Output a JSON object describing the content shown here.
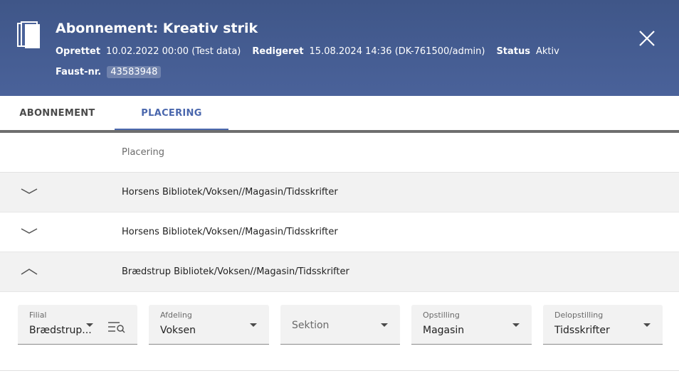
{
  "header": {
    "title": "Abonnement: Kreativ strik",
    "oprettet_label": "Oprettet",
    "oprettet_value": "10.02.2022 00:00 (Test data)",
    "redigeret_label": "Redigeret",
    "redigeret_value": "15.08.2024 14:36 (DK-761500/admin)",
    "status_label": "Status",
    "status_value": "Aktiv",
    "faust_label": "Faust-nr.",
    "faust_value": "43583948",
    "icon": "books-icon",
    "close_icon": "close-icon"
  },
  "tabs": [
    {
      "label": "ABONNEMENT",
      "active": false
    },
    {
      "label": "PLACERING",
      "active": true
    }
  ],
  "table": {
    "column_header": "Placering",
    "rows": [
      {
        "path": "Horsens Bibliotek/Voksen//Magasin/Tidsskrifter",
        "expanded": false
      },
      {
        "path": "Horsens Bibliotek/Voksen//Magasin/Tidsskrifter",
        "expanded": false
      },
      {
        "path": "Brædstrup Bibliotek/Voksen//Magasin/Tidsskrifter",
        "expanded": true
      }
    ]
  },
  "details": {
    "filial": {
      "label": "Filial",
      "value": "Brædstrup..."
    },
    "afdeling": {
      "label": "Afdeling",
      "value": "Voksen"
    },
    "sektion": {
      "placeholder": "Sektion"
    },
    "opstilling": {
      "label": "Opstilling",
      "value": "Magasin"
    },
    "delopstilling": {
      "label": "Delopstilling",
      "value": "Tidsskrifter"
    }
  },
  "colors": {
    "header_bg": "#44598e",
    "accent": "#4a67ad"
  }
}
